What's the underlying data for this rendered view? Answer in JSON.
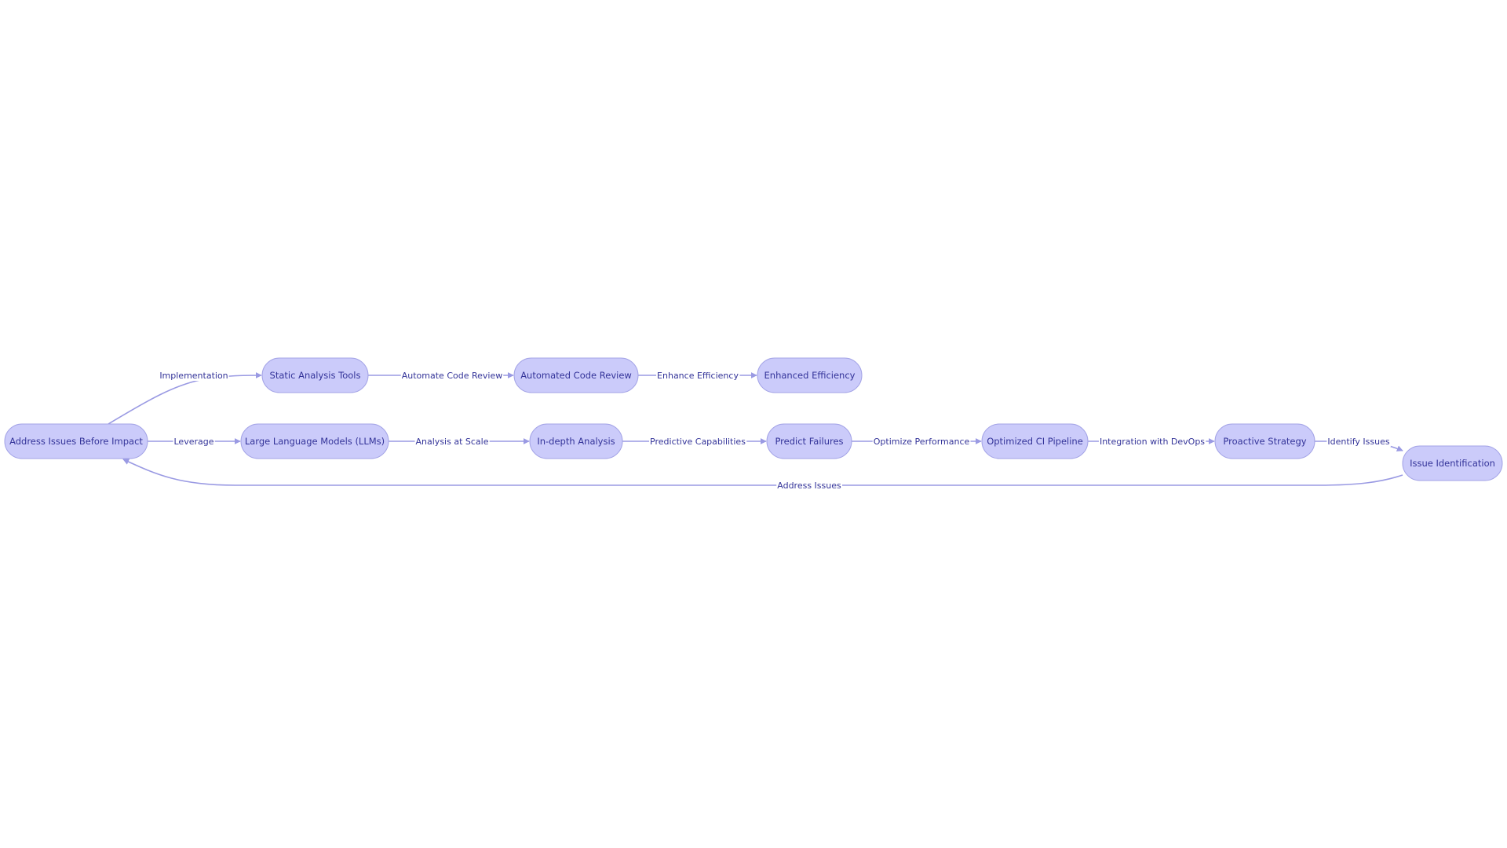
{
  "diagram": {
    "type": "flowchart",
    "colors": {
      "node_fill": "#cbcbfa",
      "node_stroke": "#a3a3e6",
      "edge": "#9a9ae3",
      "text": "#333399"
    },
    "nodes": [
      {
        "id": "A",
        "label": "Address Issues Before Impact"
      },
      {
        "id": "B",
        "label": "Static Analysis Tools"
      },
      {
        "id": "C",
        "label": "Automated Code Review"
      },
      {
        "id": "D",
        "label": "Enhanced Efficiency"
      },
      {
        "id": "E",
        "label": "Large Language Models (LLMs)"
      },
      {
        "id": "F",
        "label": "In-depth Analysis"
      },
      {
        "id": "G",
        "label": "Predict Failures"
      },
      {
        "id": "H",
        "label": "Optimized CI Pipeline"
      },
      {
        "id": "I",
        "label": "Proactive Strategy"
      },
      {
        "id": "J",
        "label": "Issue Identification"
      }
    ],
    "edges": [
      {
        "from": "A",
        "to": "B",
        "label": "Implementation"
      },
      {
        "from": "B",
        "to": "C",
        "label": "Automate Code Review"
      },
      {
        "from": "C",
        "to": "D",
        "label": "Enhance Efficiency"
      },
      {
        "from": "A",
        "to": "E",
        "label": "Leverage"
      },
      {
        "from": "E",
        "to": "F",
        "label": "Analysis at Scale"
      },
      {
        "from": "F",
        "to": "G",
        "label": "Predictive Capabilities"
      },
      {
        "from": "G",
        "to": "H",
        "label": "Optimize Performance"
      },
      {
        "from": "H",
        "to": "I",
        "label": "Integration with DevOps"
      },
      {
        "from": "I",
        "to": "J",
        "label": "Identify Issues"
      },
      {
        "from": "J",
        "to": "A",
        "label": "Address Issues"
      }
    ]
  }
}
